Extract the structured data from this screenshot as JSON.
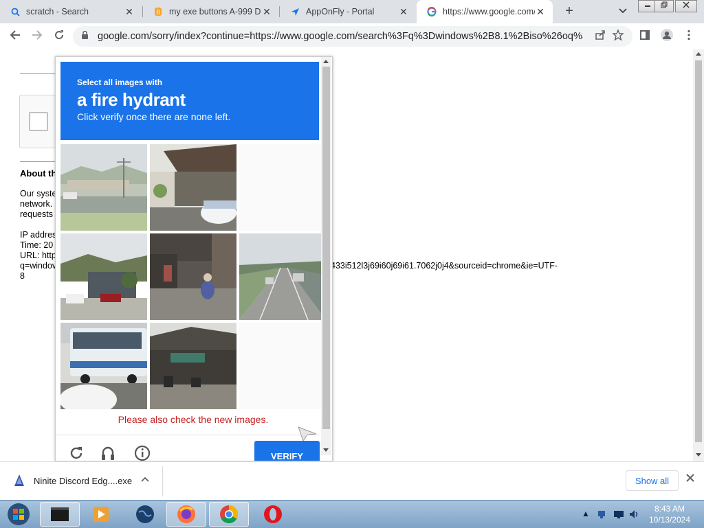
{
  "browser": {
    "tabs": [
      {
        "title": "scratch - Search",
        "icon": "search-icon"
      },
      {
        "title": "my exe buttons A-999 D...",
        "icon": "favicon-orange"
      },
      {
        "title": "AppOnFly - Portal",
        "icon": "send-icon"
      },
      {
        "title": "https://www.google.com/sorry/index?continue=...",
        "icon": "google-icon",
        "active": true
      }
    ],
    "new_tab": "+",
    "tab_search": "⌄",
    "url": "google.com/sorry/index?continue=https://www.google.com/search%3Fq%3Dwindows%2B8.1%2Biso%26oq%3D..."
  },
  "page": {
    "about_label": "About th",
    "body_lines": [
      "Our syste",
      "network.",
      "requests"
    ],
    "ip_label": "IP addres",
    "time_label": "Time: 20",
    "url_label": "URL: http",
    "url_line2": "q=windov",
    "url_tail": "433i512l3j69i60j69i61.7062j0j4&sourceid=chrome&ie=UTF-",
    "url_tail2": "8"
  },
  "captcha": {
    "instruction_small": "Select all images with",
    "instruction_big": "a fire hydrant",
    "instruction_sub": "Click verify once there are none left.",
    "warning": "Please also check the new images.",
    "verify_label": "VERIFY",
    "tiles": [
      {
        "desc": "road with utility poles",
        "state": "image"
      },
      {
        "desc": "carport with car",
        "state": "image"
      },
      {
        "desc": "",
        "state": "loading"
      },
      {
        "desc": "houses on hillside",
        "state": "image"
      },
      {
        "desc": "street with motorbike",
        "state": "image"
      },
      {
        "desc": "highway with cars",
        "state": "image"
      },
      {
        "desc": "bus on street",
        "state": "image"
      },
      {
        "desc": "roadside shops",
        "state": "image"
      },
      {
        "desc": "",
        "state": "loading"
      }
    ]
  },
  "download": {
    "file_name": "Ninite Discord Edg....exe",
    "show_all": "Show all"
  },
  "taskbar": {
    "time": "8:43 AM",
    "date": "10/13/2024"
  }
}
